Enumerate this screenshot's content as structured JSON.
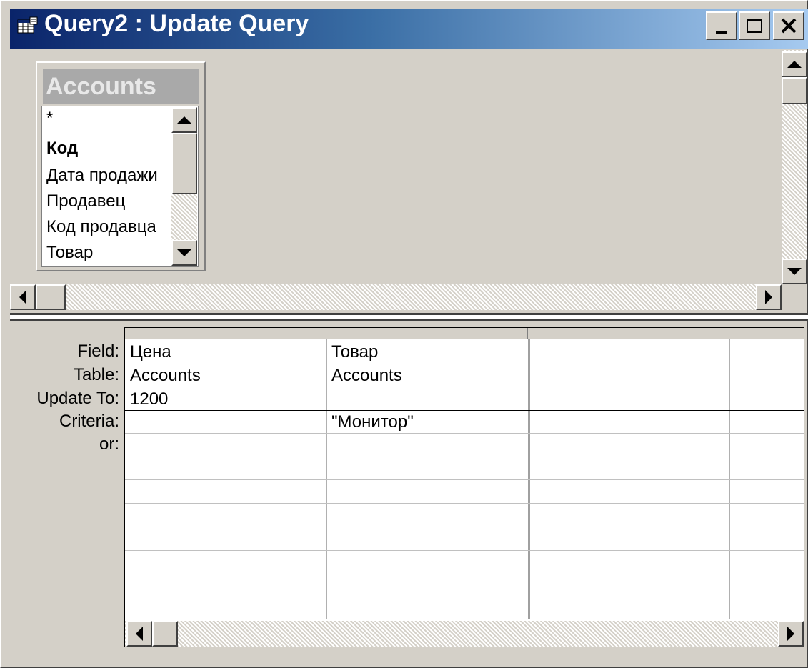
{
  "window": {
    "title": "Query2 : Update Query",
    "icon": "query-grid-icon",
    "controls": {
      "minimize": "_",
      "maximize": "☐",
      "close": "✕"
    }
  },
  "field_list": {
    "table_name": "Accounts",
    "fields": [
      "*",
      "Код",
      "Дата продажи",
      "Продавец",
      "Код продавца",
      "Товар"
    ],
    "primary_key": "Код"
  },
  "grid": {
    "row_labels": [
      "Field:",
      "Table:",
      "Update To:",
      "Criteria:",
      "or:"
    ],
    "columns": [
      {
        "field": "Цена",
        "table": "Accounts",
        "update_to": "1200",
        "criteria": "",
        "or": ""
      },
      {
        "field": "Товар",
        "table": "Accounts",
        "update_to": "",
        "criteria": "\"Монитор\"",
        "or": ""
      },
      {
        "field": "",
        "table": "",
        "update_to": "",
        "criteria": "",
        "or": ""
      },
      {
        "field": "",
        "table": "",
        "update_to": "",
        "criteria": "",
        "or": ""
      }
    ]
  },
  "colors": {
    "title_gradient_start": "#0a246a",
    "title_gradient_end": "#a6caf0",
    "face": "#d4d0c8",
    "field_list_title_bg": "#a9a9a9"
  }
}
